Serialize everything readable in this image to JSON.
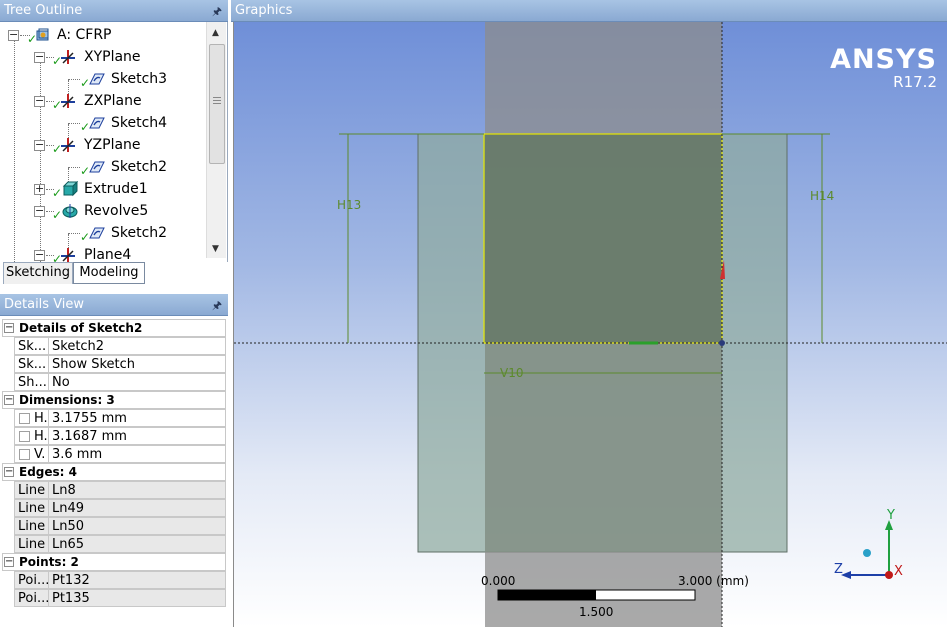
{
  "tree_outline": {
    "title": "Tree Outline",
    "pin_icon": "pin-icon",
    "items": [
      {
        "label": "A: CFRP",
        "icon": "model-icon",
        "expander": "minus"
      },
      {
        "label": "XYPlane",
        "icon": "plane-icon",
        "expander": "minus"
      },
      {
        "label": "Sketch3",
        "icon": "sketch-icon",
        "expander": "none"
      },
      {
        "label": "ZXPlane",
        "icon": "plane-icon",
        "expander": "minus"
      },
      {
        "label": "Sketch4",
        "icon": "sketch-icon",
        "expander": "none"
      },
      {
        "label": "YZPlane",
        "icon": "plane-icon",
        "expander": "minus"
      },
      {
        "label": "Sketch2",
        "icon": "sketch-icon",
        "expander": "none"
      },
      {
        "label": "Extrude1",
        "icon": "extrude-icon",
        "expander": "plus"
      },
      {
        "label": "Revolve5",
        "icon": "revolve-icon",
        "expander": "minus"
      },
      {
        "label": "Sketch2",
        "icon": "sketch-icon",
        "expander": "none"
      },
      {
        "label": "Plane4",
        "icon": "plane-icon",
        "expander": "minus"
      }
    ]
  },
  "tabs": {
    "sketching": "Sketching",
    "modeling": "Modeling"
  },
  "details_view": {
    "title": "Details View",
    "groups": [
      {
        "title": "Details of Sketch2",
        "rows": [
          {
            "name": "Sk...",
            "value": "Sketch2"
          },
          {
            "name": "Sk...",
            "value": "Show Sketch"
          },
          {
            "name": "Sh...",
            "value": "No"
          }
        ]
      },
      {
        "title": "Dimensions: 3",
        "rows": [
          {
            "name": "H.",
            "value": "3.1755 mm"
          },
          {
            "name": "H.",
            "value": "3.1687 mm"
          },
          {
            "name": "V.",
            "value": "3.6 mm"
          }
        ]
      },
      {
        "title": "Edges: 4",
        "rows": [
          {
            "name": "Line",
            "value": "Ln8"
          },
          {
            "name": "Line",
            "value": "Ln49"
          },
          {
            "name": "Line",
            "value": "Ln50"
          },
          {
            "name": "Line",
            "value": "Ln65"
          }
        ]
      },
      {
        "title": "Points: 2",
        "rows": [
          {
            "name": "Poi...",
            "value": "Pt132"
          },
          {
            "name": "Poi...",
            "value": "Pt135"
          }
        ]
      }
    ]
  },
  "graphics": {
    "title": "Graphics",
    "logo": {
      "brand": "ANSYS",
      "version": "R17.2"
    },
    "dimensions": {
      "h13": "H13",
      "h14": "H14",
      "v10": "V10"
    },
    "scale": {
      "min": "0.000",
      "max": "3.000 (mm)",
      "mid": "1.500"
    },
    "axes": {
      "y": "Y",
      "z": "Z",
      "x": "X"
    },
    "colors": {
      "bg_top": "#6f8fd8",
      "body": "#8ba59b",
      "sketch": "#e6e600",
      "dims": "#5c8a2c"
    }
  }
}
